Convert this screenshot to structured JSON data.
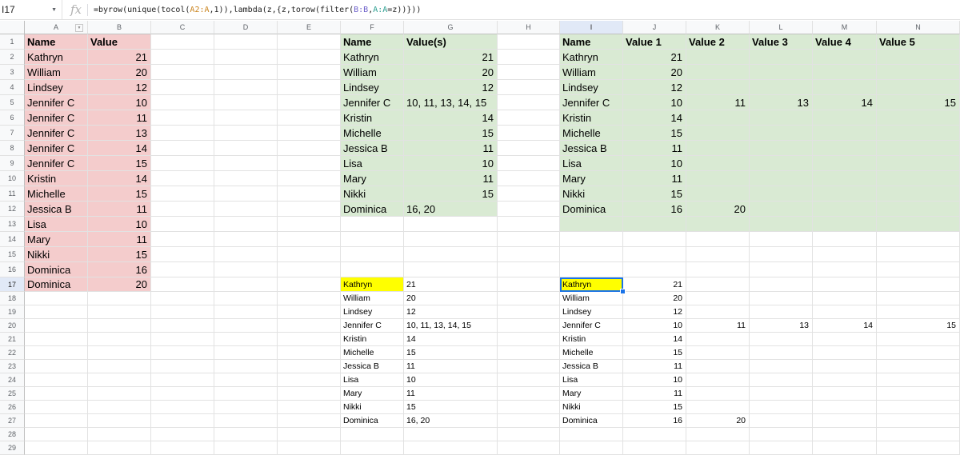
{
  "formula_bar": {
    "name_box": "I17",
    "fx_label": "fx",
    "formula_parts": [
      {
        "t": "=byrow(unique(tocol(",
        "c": ""
      },
      {
        "t": "A2:A",
        "c": "rA"
      },
      {
        "t": ",1)),lambda(z,{z,torow(filter(",
        "c": ""
      },
      {
        "t": "B:B",
        "c": "rB"
      },
      {
        "t": ",",
        "c": ""
      },
      {
        "t": "A:A",
        "c": "rC"
      },
      {
        "t": "=z))}))",
        "c": ""
      }
    ]
  },
  "columns": [
    "A",
    "B",
    "C",
    "D",
    "E",
    "F",
    "G",
    "H",
    "I",
    "J",
    "K",
    "L",
    "M",
    "N"
  ],
  "rows": [
    "1",
    "2",
    "3",
    "4",
    "5",
    "6",
    "7",
    "8",
    "9",
    "10",
    "11",
    "12",
    "13",
    "14",
    "15",
    "16",
    "17",
    "18",
    "19",
    "20",
    "21",
    "22",
    "23",
    "24",
    "25",
    "26",
    "27",
    "28",
    "29"
  ],
  "selected": {
    "col": "I",
    "row": "17"
  },
  "source_table": {
    "headers": [
      "Name",
      "Value"
    ],
    "rows": [
      [
        "Kathryn",
        "21"
      ],
      [
        "William",
        "20"
      ],
      [
        "Lindsey",
        "12"
      ],
      [
        "Jennifer C",
        "10"
      ],
      [
        "Jennifer C",
        "11"
      ],
      [
        "Jennifer C",
        "13"
      ],
      [
        "Jennifer C",
        "14"
      ],
      [
        "Jennifer C",
        "15"
      ],
      [
        "Kristin",
        "14"
      ],
      [
        "Michelle",
        "15"
      ],
      [
        "Jessica B",
        "11"
      ],
      [
        "Lisa",
        "10"
      ],
      [
        "Mary",
        "11"
      ],
      [
        "Nikki",
        "15"
      ],
      [
        "Dominica",
        "16"
      ],
      [
        "Dominica",
        "20"
      ]
    ]
  },
  "joined_table": {
    "headers": [
      "Name",
      "Value(s)"
    ],
    "rows": [
      [
        "Kathryn",
        "21"
      ],
      [
        "William",
        "20"
      ],
      [
        "Lindsey",
        "12"
      ],
      [
        "Jennifer C",
        "10, 11, 13, 14, 15"
      ],
      [
        "Kristin",
        "14"
      ],
      [
        "Michelle",
        "15"
      ],
      [
        "Jessica B",
        "11"
      ],
      [
        "Lisa",
        "10"
      ],
      [
        "Mary",
        "11"
      ],
      [
        "Nikki",
        "15"
      ],
      [
        "Dominica",
        "16, 20"
      ]
    ]
  },
  "spread_table": {
    "headers": [
      "Name",
      "Value 1",
      "Value 2",
      "Value 3",
      "Value 4",
      "Value 5"
    ],
    "rows": [
      [
        "Kathryn",
        "21",
        "",
        "",
        "",
        ""
      ],
      [
        "William",
        "20",
        "",
        "",
        "",
        ""
      ],
      [
        "Lindsey",
        "12",
        "",
        "",
        "",
        ""
      ],
      [
        "Jennifer C",
        "10",
        "11",
        "13",
        "14",
        "15"
      ],
      [
        "Kristin",
        "14",
        "",
        "",
        "",
        ""
      ],
      [
        "Michelle",
        "15",
        "",
        "",
        "",
        ""
      ],
      [
        "Jessica B",
        "11",
        "",
        "",
        "",
        ""
      ],
      [
        "Lisa",
        "10",
        "",
        "",
        "",
        ""
      ],
      [
        "Mary",
        "11",
        "",
        "",
        "",
        ""
      ],
      [
        "Nikki",
        "15",
        "",
        "",
        "",
        ""
      ],
      [
        "Dominica",
        "16",
        "20",
        "",
        "",
        ""
      ]
    ]
  },
  "joined_output": {
    "rows": [
      [
        "Kathryn",
        "21"
      ],
      [
        "William",
        "20"
      ],
      [
        "Lindsey",
        "12"
      ],
      [
        "Jennifer C",
        "10, 11, 13, 14, 15"
      ],
      [
        "Kristin",
        "14"
      ],
      [
        "Michelle",
        "15"
      ],
      [
        "Jessica B",
        "11"
      ],
      [
        "Lisa",
        "10"
      ],
      [
        "Mary",
        "11"
      ],
      [
        "Nikki",
        "15"
      ],
      [
        "Dominica",
        "16, 20"
      ]
    ]
  },
  "spread_output": {
    "rows": [
      [
        "Kathryn",
        "21",
        "",
        "",
        "",
        ""
      ],
      [
        "William",
        "20",
        "",
        "",
        "",
        ""
      ],
      [
        "Lindsey",
        "12",
        "",
        "",
        "",
        ""
      ],
      [
        "Jennifer C",
        "10",
        "11",
        "13",
        "14",
        "15"
      ],
      [
        "Kristin",
        "14",
        "",
        "",
        "",
        ""
      ],
      [
        "Michelle",
        "15",
        "",
        "",
        "",
        ""
      ],
      [
        "Jessica B",
        "11",
        "",
        "",
        "",
        ""
      ],
      [
        "Lisa",
        "10",
        "",
        "",
        "",
        ""
      ],
      [
        "Mary",
        "11",
        "",
        "",
        "",
        ""
      ],
      [
        "Nikki",
        "15",
        "",
        "",
        "",
        ""
      ],
      [
        "Dominica",
        "16",
        "20",
        "",
        "",
        ""
      ]
    ]
  },
  "colors": {
    "pink": "#f4cccc",
    "green": "#d9ead3",
    "yellow": "#ffff00",
    "selection": "#1a73e8"
  }
}
